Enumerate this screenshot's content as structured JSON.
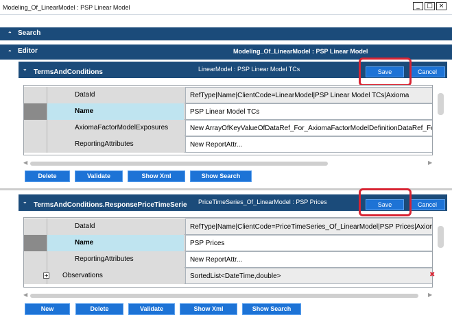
{
  "window": {
    "title": "Modeling_Of_LinearModel : PSP Linear Model",
    "minimize": "_",
    "maximize": "□",
    "close": "×"
  },
  "nav": {
    "search_label": "Search",
    "editor_label": "Editor",
    "editor_context": "Modeling_Of_LinearModel : PSP Linear Model"
  },
  "panel1": {
    "name": "TermsAndConditions",
    "context": "LinearModel : PSP Linear Model TCs",
    "save": "Save",
    "cancel": "Cancel",
    "rows": [
      {
        "key": "DataId",
        "value": "RefType|Name|ClientCode=LinearModel|PSP Linear Model TCs|Axioma"
      },
      {
        "key": "Name",
        "value": "PSP Linear Model TCs"
      },
      {
        "key": "AxiomaFactorModelExposures",
        "value": "New ArrayOfKeyValueOfDataRef_For_AxiomaFactorModelDefinitionDataRef_For_Ax"
      },
      {
        "key": "ReportingAttributes",
        "value": "New ReportAttr..."
      }
    ],
    "buttons": {
      "delete": "Delete",
      "validate": "Validate",
      "show_xml": "Show Xml",
      "show_search": "Show Search"
    }
  },
  "panel2": {
    "name": "TermsAndConditions.ResponsePriceTimeSerie",
    "context": "PriceTimeSeries_Of_LinearModel : PSP Prices",
    "save": "Save",
    "cancel": "Cancel",
    "rows": [
      {
        "key": "DataId",
        "value": "RefType|Name|ClientCode=PriceTimeSeries_Of_LinearModel|PSP Prices|Axioma"
      },
      {
        "key": "Name",
        "value": "PSP Prices"
      },
      {
        "key": "ReportingAttributes",
        "value": "New ReportAttr..."
      },
      {
        "key": "Observations",
        "value": "SortedList<DateTime,double>",
        "expander": "+"
      }
    ],
    "buttons": {
      "new": "New",
      "delete": "Delete",
      "validate": "Validate",
      "show_xml": "Show Xml",
      "show_search": "Show Search"
    }
  },
  "icons": {
    "chevron": "⌃",
    "chevron_down": "⌄",
    "scroll_left": "◀",
    "scroll_right": "▶",
    "delete_x": "✖"
  },
  "colors": {
    "nav": "#1b4b7a",
    "button": "#1d73d6",
    "highlight": "#d82433",
    "active_row": "#bfe4f0"
  }
}
